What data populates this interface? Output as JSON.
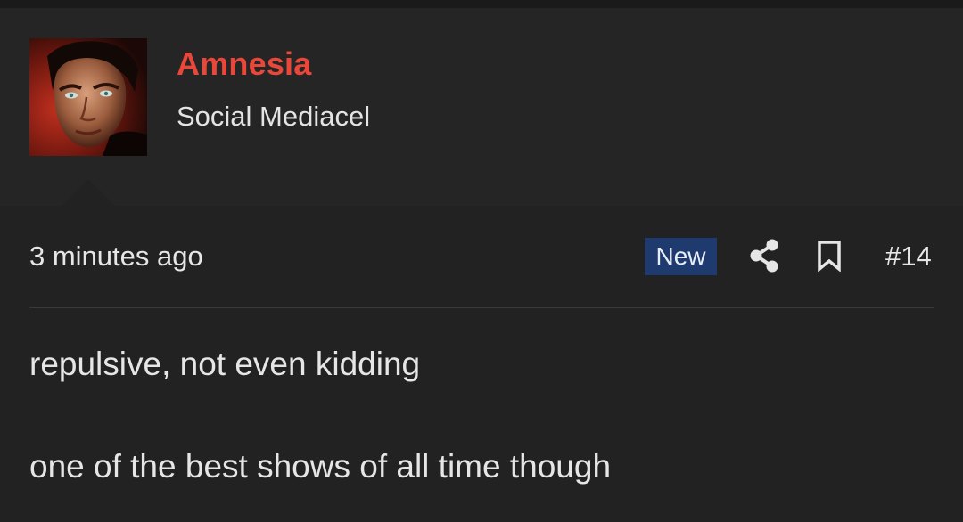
{
  "user": {
    "name": "Amnesia",
    "title": "Social Mediacel",
    "avatar_icon": "profile-photo"
  },
  "post": {
    "timestamp": "3 minutes ago",
    "badge": "New",
    "number": "#14",
    "actions": {
      "share_icon": "share-icon",
      "bookmark_icon": "bookmark-icon"
    },
    "body": [
      "repulsive, not even kidding",
      "one of the best shows of all time though"
    ]
  },
  "colors": {
    "username": "#e8473a",
    "badge_bg": "#1f3a6e",
    "background": "#222223",
    "user_block_bg": "#252526"
  }
}
